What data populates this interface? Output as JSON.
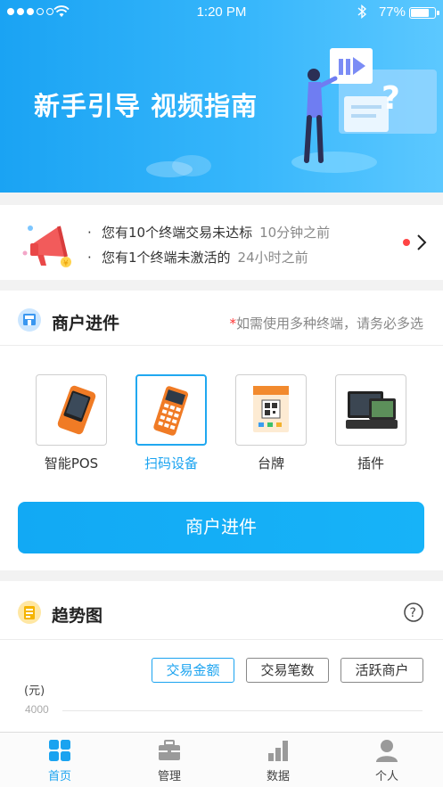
{
  "status_bar": {
    "time": "1:20 PM",
    "battery": "77%",
    "battery_level": 0.77
  },
  "banner": {
    "title": "新手引导  视频指南"
  },
  "notice": {
    "items": [
      {
        "text": "您有10个终端交易未达标",
        "time": "10分钟之前"
      },
      {
        "text": "您有1个终端未激活的",
        "time": "24小时之前"
      }
    ]
  },
  "merchant": {
    "title": "商户进件",
    "note_star": "*",
    "note": "如需使用多种终端，请务必多选",
    "terminals": [
      {
        "label": "智能POS",
        "icon": "smart-pos-icon",
        "selected": false
      },
      {
        "label": "扫码设备",
        "icon": "scanner-device-icon",
        "selected": true
      },
      {
        "label": "台牌",
        "icon": "table-card-icon",
        "selected": false
      },
      {
        "label": "插件",
        "icon": "plugin-device-icon",
        "selected": false
      }
    ],
    "button_label": "商户进件"
  },
  "trend": {
    "title": "趋势图",
    "filters": [
      "交易金额",
      "交易笔数",
      "活跃商户"
    ],
    "active_filter": "交易金额",
    "y_unit": "(元)",
    "y_top_tick": "4000"
  },
  "tabbar": {
    "tabs": [
      {
        "label": "首页",
        "icon": "home-grid-icon",
        "active": true
      },
      {
        "label": "管理",
        "icon": "briefcase-icon",
        "active": false
      },
      {
        "label": "数据",
        "icon": "bar-chart-icon",
        "active": false
      },
      {
        "label": "个人",
        "icon": "person-icon",
        "active": false
      }
    ]
  },
  "colors": {
    "primary": "#1aa3f0",
    "alert": "#f44444"
  }
}
